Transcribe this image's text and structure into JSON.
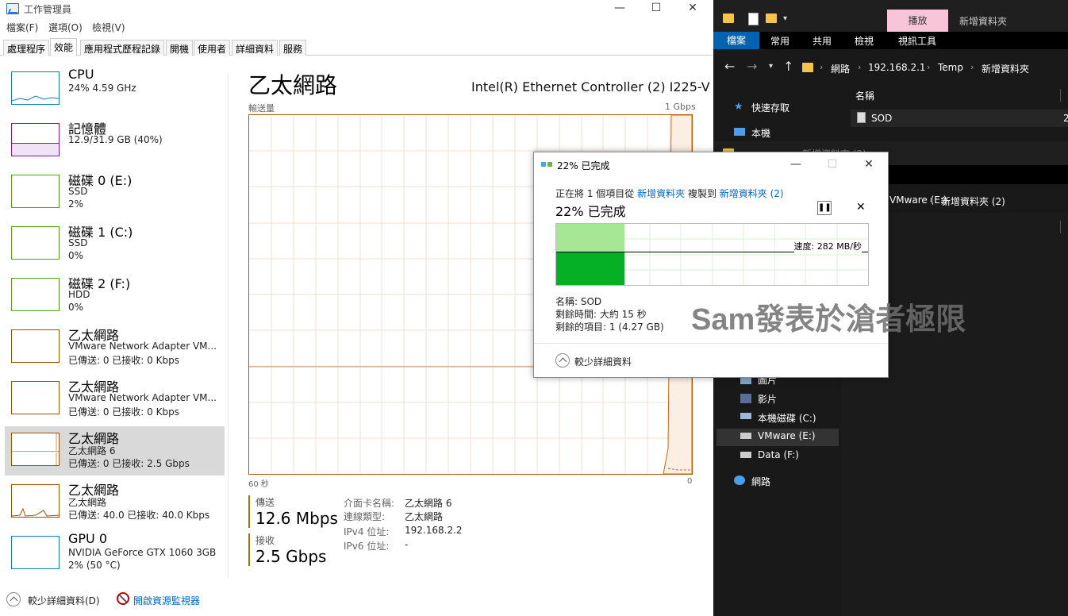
{
  "task_manager": {
    "title": "工作管理員",
    "menu": [
      "檔案(F)",
      "選項(O)",
      "檢視(V)"
    ],
    "tabs": [
      "處理程序",
      "效能",
      "應用程式歷程記錄",
      "開機",
      "使用者",
      "詳細資料",
      "服務"
    ],
    "active_tab": "效能",
    "sidebar": [
      {
        "title": "CPU",
        "l2": "24%  4.59 GHz",
        "l3": "",
        "color": "#117dbb"
      },
      {
        "title": "記憶體",
        "l2": "12.9/31.9 GB (40%)",
        "l3": "",
        "color": "#8b12ae"
      },
      {
        "title": "磁碟 0 (E:)",
        "l2": "SSD",
        "l3": "2%",
        "color": "#4da60c"
      },
      {
        "title": "磁碟 1 (C:)",
        "l2": "SSD",
        "l3": "0%",
        "color": "#4da60c"
      },
      {
        "title": "磁碟 2 (F:)",
        "l2": "HDD",
        "l3": "0%",
        "color": "#4da60c"
      },
      {
        "title": "乙太網路",
        "l2": "VMware Network Adapter VM...",
        "l3": "已傳送: 0 已接收: 0 Kbps",
        "color": "#a74f01"
      },
      {
        "title": "乙太網路",
        "l2": "VMware Network Adapter VM...",
        "l3": "已傳送: 0 已接收: 0 Kbps",
        "color": "#a74f01"
      },
      {
        "title": "乙太網路",
        "l2": "乙太網路 6",
        "l3": "已傳送: 0 已接收: 2.5 Gbps",
        "color": "#a74f01"
      },
      {
        "title": "乙太網路",
        "l2": "乙太網路",
        "l3": "已傳送: 40.0 已接收: 40.0 Kbps",
        "color": "#a74f01"
      },
      {
        "title": "GPU 0",
        "l2": "NVIDIA GeForce GTX 1060 3GB",
        "l3": "2% (50 °C)",
        "color": "#117dbb"
      }
    ],
    "selected_index": 7,
    "main": {
      "title": "乙太網路",
      "adapter": "Intel(R) Ethernet Controller (2) I225-V",
      "graph_label": "輸送量",
      "graph_max": "1 Gbps",
      "graph_left": "60 秒",
      "graph_right": "0",
      "send_label": "傳送",
      "send_value": "12.6 Mbps",
      "recv_label": "接收",
      "recv_value": "2.5 Gbps",
      "info": [
        {
          "label": "介面卡名稱:",
          "value": "乙太網路 6"
        },
        {
          "label": "連線類型:",
          "value": "乙太網路"
        },
        {
          "label": "IPv4 位址:",
          "value": "192.168.2.2"
        },
        {
          "label": "IPv6 位址:",
          "value": "-"
        }
      ]
    },
    "footer": {
      "fewer_details": "較少詳細資料(D)",
      "open_monitor": "開啟資源監視器"
    }
  },
  "explorer": {
    "play_tab": "播放",
    "window_title": "新增資料夾",
    "ribbon": [
      "檔案",
      "常用",
      "共用",
      "檢視",
      "視訊工具"
    ],
    "path": [
      "網路",
      "192.168.2.1",
      "Temp",
      "新增資料夾"
    ],
    "column_name": "名稱",
    "file_name": "SOD",
    "file_extra": "2",
    "nav": [
      "快速存取",
      "本機",
      "圖片",
      "影片",
      "本機磁碟 (C:)",
      "VMware (E:)",
      "Data (F:)",
      "網路"
    ],
    "second_window_title": "新增資料夾 (2)",
    "second_path": [
      "VMware (E:)",
      "新增資料夾 (2)"
    ]
  },
  "copy_dialog": {
    "title": "22% 已完成",
    "desc_prefix": "正在將 1 個項目從",
    "source": "新增資料夾",
    "desc_middle": "複製到",
    "dest": "新增資料夾 (2)",
    "percent_text": "22% 已完成",
    "progress": 0.22,
    "speed": "速度: 282 MB/秒",
    "name_line": "名稱: SOD",
    "time_line": "剩餘時間: 大約 15 秒",
    "items_line": "剩餘的項目: 1 (4.27 GB)",
    "fewer_details": "較少詳細資料"
  },
  "watermark": "Sam發表於滄者極限"
}
